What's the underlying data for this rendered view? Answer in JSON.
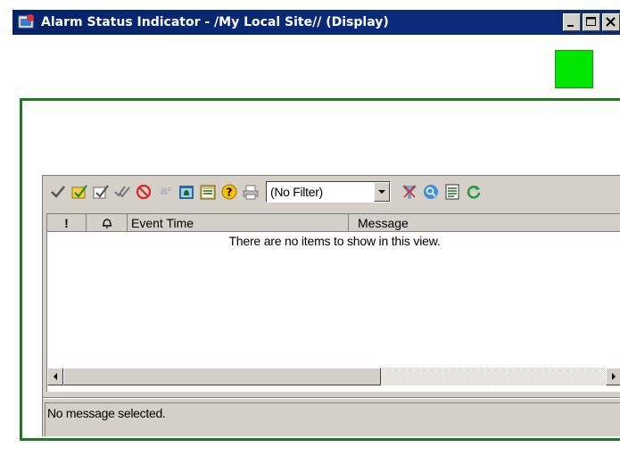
{
  "window": {
    "title": "Alarm Status Indicator - /My Local Site// (Display)",
    "app_icon": "alarm-app-icon",
    "minimize_icon": "minimize-icon",
    "maximize_icon": "maximize-icon",
    "close_icon": "close-icon"
  },
  "indicator": {
    "state_color": "#00e600",
    "border_color": "#1f7a1f"
  },
  "toolbar": {
    "icons": [
      "ack-icon",
      "ack-selected-icon",
      "ack-page-icon",
      "ack-all-icon",
      "disable-icon",
      "silence-icon",
      "shelve-icon",
      "details-icon",
      "help-icon",
      "print-icon"
    ],
    "filter": {
      "selected": "(No Filter)"
    },
    "right_icons": [
      "filter-icon",
      "find-icon",
      "properties-icon",
      "refresh-icon"
    ]
  },
  "list": {
    "columns": [
      "!",
      "",
      "Event Time",
      "Message"
    ],
    "empty_text": "There are no items to show in this view."
  },
  "status": {
    "text": "No message selected."
  }
}
